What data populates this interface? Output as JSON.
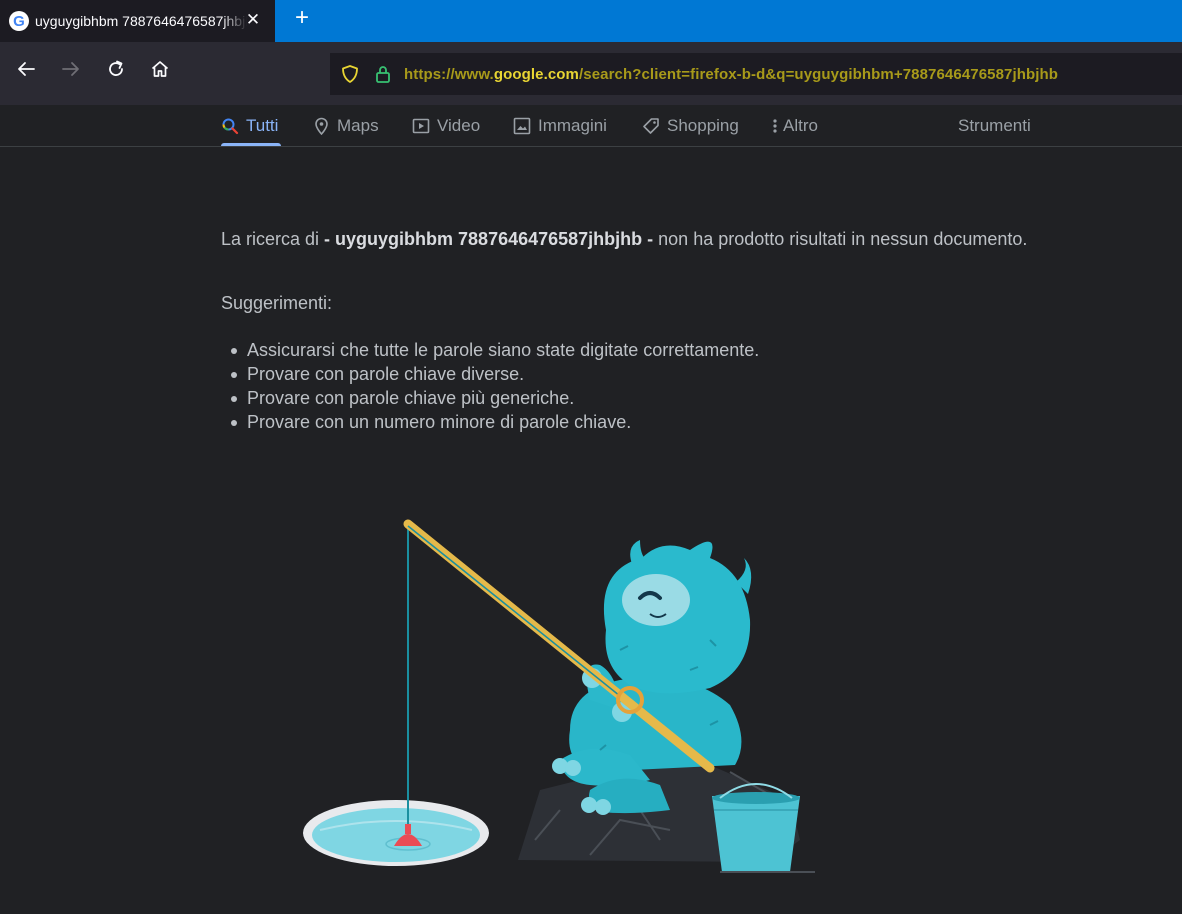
{
  "browser": {
    "tab": {
      "title": "uyguygibhbm 7887646476587jhbjhb",
      "favicon": "google-favicon",
      "favicon_letter": "G",
      "close_glyph": "✕"
    },
    "new_tab_glyph": "+",
    "nav": {
      "back_icon": "back-arrow-icon",
      "forward_icon": "forward-arrow-icon",
      "reload_icon": "reload-icon",
      "home_icon": "home-icon"
    },
    "url": {
      "prefix": "https://www.",
      "host": "google.com",
      "path": "/search?client=firefox-b-d&q=uyguygibhbm+7887646476587jhbjhb"
    },
    "colors": {
      "tabbar": "#0078d4",
      "url_accent": "#e8d533",
      "lock": "#38c172"
    }
  },
  "search_nav": {
    "tabs": [
      {
        "label": "Tutti",
        "icon": "search-icon",
        "active": true
      },
      {
        "label": "Maps",
        "icon": "map-pin-icon"
      },
      {
        "label": "Video",
        "icon": "video-icon"
      },
      {
        "label": "Immagini",
        "icon": "image-icon"
      },
      {
        "label": "Shopping",
        "icon": "tag-icon"
      },
      {
        "label": "Altro",
        "icon": "more-vert-icon"
      }
    ],
    "tools": "Strumenti"
  },
  "results": {
    "prefix": "La ricerca di ",
    "query": "- uyguygibhbm 7887646476587jhbjhb -",
    "suffix": " non ha prodotto risultati in nessun documento.",
    "suggestions_title": "Suggerimenti:",
    "suggestions": [
      "Assicurarsi che tutte le parole siano state digitate correttamente.",
      "Provare con parole chiave diverse.",
      "Provare con parole chiave più generiche.",
      "Provare con un numero minore di parole chiave."
    ]
  }
}
